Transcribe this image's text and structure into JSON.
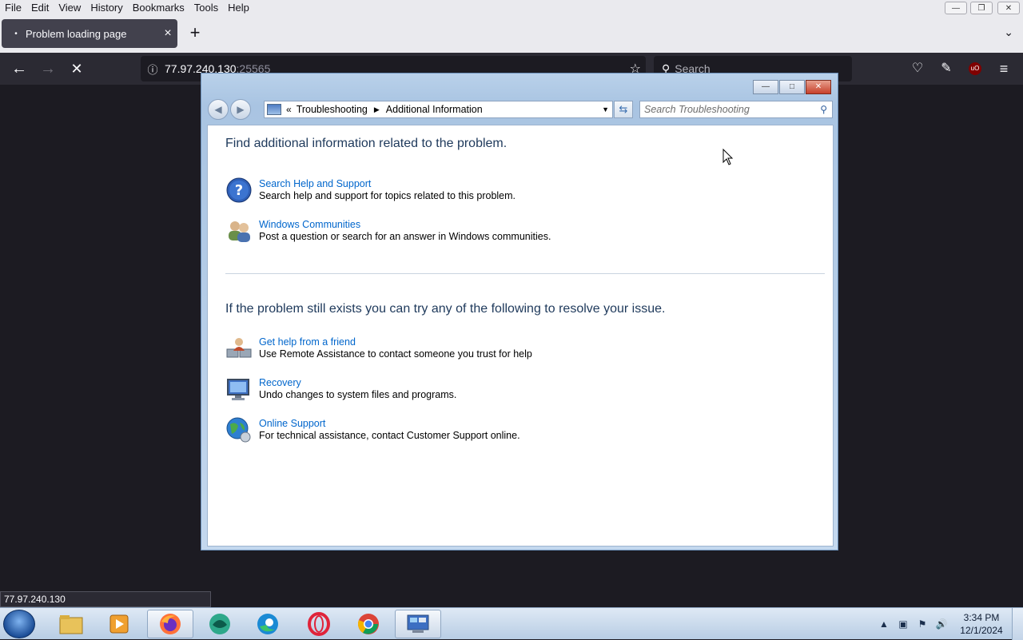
{
  "firefox": {
    "menu": [
      "File",
      "Edit",
      "View",
      "History",
      "Bookmarks",
      "Tools",
      "Help"
    ],
    "tab": {
      "title": "Problem loading page"
    },
    "url": {
      "host": "77.97.240.130",
      "port": ":25565"
    },
    "search_placeholder": "Search",
    "status_text": "77.97.240.130"
  },
  "dialog": {
    "breadcrumb": {
      "chevrons": "«",
      "parent": "Troubleshooting",
      "current": "Additional Information"
    },
    "search_placeholder": "Search Troubleshooting",
    "section1": {
      "heading": "Find additional information related to the problem.",
      "items": [
        {
          "icon": "help-icon",
          "link": "Search Help and Support",
          "desc": "Search help and support for topics related to this problem."
        },
        {
          "icon": "communities-icon",
          "link": "Windows Communities",
          "desc": "Post a question or search for an answer in Windows communities."
        }
      ]
    },
    "section2": {
      "heading": "If the problem still exists you can try any of the following to resolve your issue.",
      "items": [
        {
          "icon": "remote-assistance-icon",
          "link": "Get help from a friend",
          "desc": "Use Remote Assistance to contact someone you trust for help"
        },
        {
          "icon": "recovery-icon",
          "link": "Recovery",
          "desc": "Undo changes to system files and programs."
        },
        {
          "icon": "globe-icon",
          "link": "Online Support",
          "desc": "For technical assistance, contact Customer Support online."
        }
      ]
    }
  },
  "taskbar": {
    "apps": [
      "file-explorer",
      "media-player",
      "firefox",
      "app-green",
      "edge",
      "opera",
      "chrome",
      "control-panel"
    ],
    "clock": {
      "time": "3:34 PM",
      "date": "12/1/2024"
    }
  },
  "colors": {
    "heading": "#1e395b",
    "link": "#0066cc",
    "browser_dark": "#1c1b22"
  }
}
